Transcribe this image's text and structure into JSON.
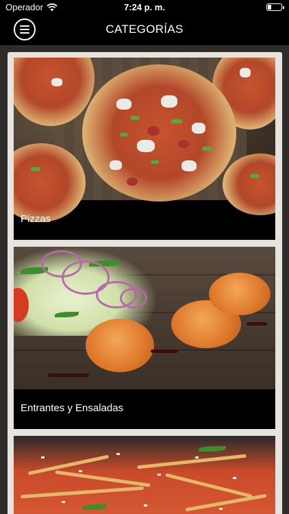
{
  "status_bar": {
    "carrier": "Operador",
    "time": "7:24 p. m."
  },
  "nav": {
    "title": "CATEGORÍAS",
    "menu_icon": "hamburger-menu-icon"
  },
  "categories": [
    {
      "label": "Pizzas",
      "image": "pizzas-photo"
    },
    {
      "label": "Entrantes y Ensaladas",
      "image": "entrantes-photo"
    },
    {
      "label": "",
      "image": "pasta-photo"
    }
  ],
  "colors": {
    "background": "#000000",
    "content_bg": "#2e2b29",
    "panel_bg": "#e7e3df",
    "card_label_bg": "#000000",
    "text": "#ffffff"
  }
}
